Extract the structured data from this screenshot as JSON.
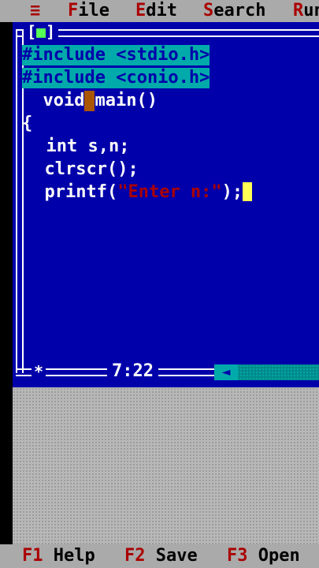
{
  "menu": {
    "system": "≡",
    "items": [
      {
        "hot": "F",
        "rest": "ile"
      },
      {
        "hot": "E",
        "rest": "dit"
      },
      {
        "hot": "S",
        "rest": "earch"
      },
      {
        "hot": "R",
        "rest": "un"
      }
    ]
  },
  "window": {
    "close_box": "[■]",
    "close_box_left": "[",
    "close_box_mark": "■",
    "close_box_right": "]",
    "cursor_position": "7:22",
    "resize_marker": "*",
    "scroll_arrow": "◄"
  },
  "code": {
    "lines": [
      "#include <stdio.h>",
      "#include <conio.h>",
      "  void",
      "main()",
      "{",
      "  int s,n;",
      "  clrscr();",
      "  printf(",
      "\"Enter n:\"",
      ");"
    ]
  },
  "status": {
    "keys": [
      {
        "key": "F1",
        "label": "Help"
      },
      {
        "key": "F2",
        "label": "Save"
      },
      {
        "key": "F3",
        "label": "Open"
      }
    ]
  },
  "colors": {
    "editor_bg": "#0000aa",
    "menu_bg": "#aaaaaa",
    "hotkey": "#aa0000",
    "selection": "#00aaaa",
    "cursor": "#ffff55"
  }
}
